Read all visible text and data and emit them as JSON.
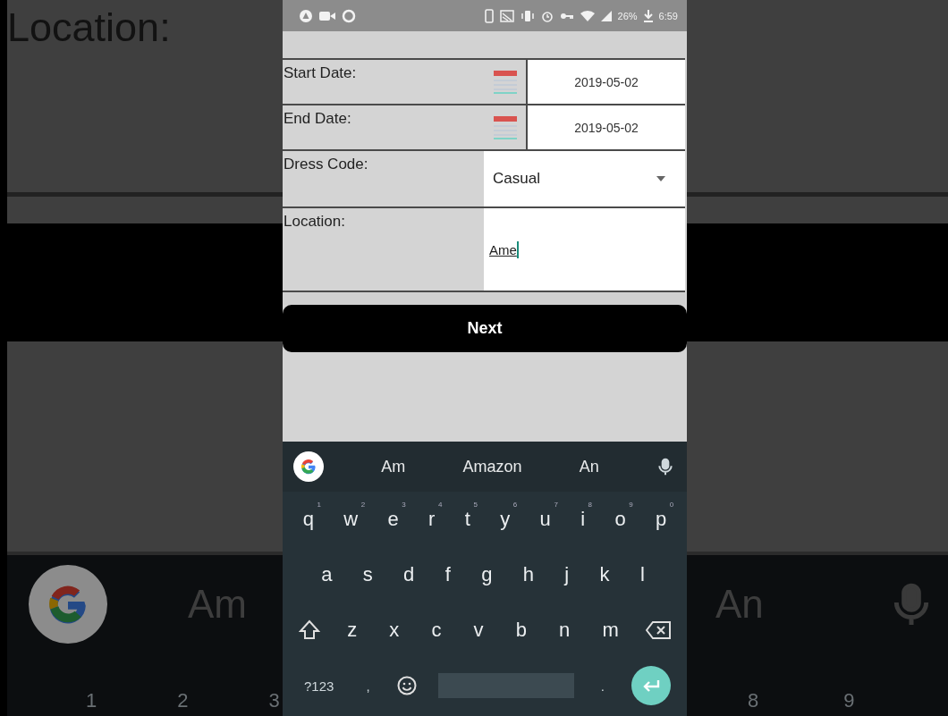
{
  "backdrop": {
    "left": {
      "label": "Location:",
      "suggestion": "Am",
      "digits": [
        "1",
        "2",
        "3"
      ]
    },
    "right": {
      "suggestion": "An",
      "digits": [
        "8",
        "9"
      ]
    }
  },
  "status_bar": {
    "battery": "26%",
    "time": "6:59"
  },
  "form": {
    "rows": [
      {
        "kind": "date",
        "label": "Start Date:",
        "value": "2019-05-02"
      },
      {
        "kind": "date",
        "label": "End Date:",
        "value": "2019-05-02"
      },
      {
        "kind": "select",
        "label": "Dress Code:",
        "value": "Casual"
      },
      {
        "kind": "text",
        "label": "Location:",
        "value": "Ame",
        "composing": true
      }
    ]
  },
  "next_button": "Next",
  "keyboard": {
    "suggestions": [
      "Am",
      "Amazon",
      "An"
    ],
    "rows": [
      [
        {
          "kind": "char",
          "key": "q",
          "hint": "1"
        },
        {
          "kind": "char",
          "key": "w",
          "hint": "2"
        },
        {
          "kind": "char",
          "key": "e",
          "hint": "3"
        },
        {
          "kind": "char",
          "key": "r",
          "hint": "4"
        },
        {
          "kind": "char",
          "key": "t",
          "hint": "5"
        },
        {
          "kind": "char",
          "key": "y",
          "hint": "6"
        },
        {
          "kind": "char",
          "key": "u",
          "hint": "7"
        },
        {
          "kind": "char",
          "key": "i",
          "hint": "8"
        },
        {
          "kind": "char",
          "key": "o",
          "hint": "9"
        },
        {
          "kind": "char",
          "key": "p",
          "hint": "0"
        }
      ],
      [
        {
          "kind": "char",
          "key": "a"
        },
        {
          "kind": "char",
          "key": "s"
        },
        {
          "kind": "char",
          "key": "d"
        },
        {
          "kind": "char",
          "key": "f"
        },
        {
          "kind": "char",
          "key": "g"
        },
        {
          "kind": "char",
          "key": "h"
        },
        {
          "kind": "char",
          "key": "j"
        },
        {
          "kind": "char",
          "key": "k"
        },
        {
          "kind": "char",
          "key": "l"
        }
      ],
      [
        {
          "kind": "shift"
        },
        {
          "kind": "char",
          "key": "z"
        },
        {
          "kind": "char",
          "key": "x"
        },
        {
          "kind": "char",
          "key": "c"
        },
        {
          "kind": "char",
          "key": "v"
        },
        {
          "kind": "char",
          "key": "b"
        },
        {
          "kind": "char",
          "key": "n"
        },
        {
          "kind": "char",
          "key": "m"
        },
        {
          "kind": "backspace"
        }
      ],
      [
        {
          "kind": "char",
          "key": "?123"
        },
        {
          "kind": "char",
          "key": ","
        },
        {
          "kind": "emoji"
        },
        {
          "kind": "space"
        },
        {
          "kind": "char",
          "key": "."
        },
        {
          "kind": "enter"
        }
      ]
    ]
  }
}
